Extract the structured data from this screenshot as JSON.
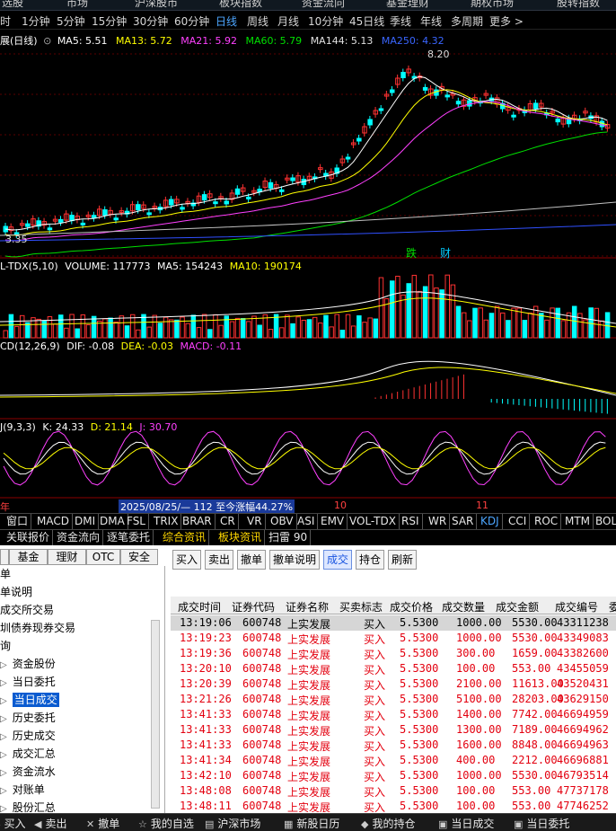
{
  "top_nav": [
    "选股",
    "市场",
    "沪深股市",
    "板块指数",
    "资金流向",
    "基金理财",
    "期权市场",
    "股转指数"
  ],
  "periods": [
    {
      "label": "时"
    },
    {
      "label": "1分钟"
    },
    {
      "label": "5分钟"
    },
    {
      "label": "15分钟"
    },
    {
      "label": "30分钟"
    },
    {
      "label": "60分钟"
    },
    {
      "label": "日线",
      "active": true
    },
    {
      "label": "周线"
    },
    {
      "label": "月线"
    },
    {
      "label": "10分钟"
    },
    {
      "label": "45日线"
    },
    {
      "label": "季线"
    },
    {
      "label": "年线"
    },
    {
      "label": "多周期"
    },
    {
      "label": "更多 >"
    }
  ],
  "kline": {
    "title": "展(日线)",
    "ma5": "MA5: 5.51",
    "ma13": "MA13: 5.72",
    "ma21": "MA21: 5.92",
    "ma60": "MA60: 5.79",
    "ma144": "MA144: 5.13",
    "ma250": "MA250: 4.32",
    "high_label": "8.20",
    "low_label": "3.35",
    "tags": [
      "跌",
      "财"
    ]
  },
  "volume": {
    "title": "L-TDX(5,10)",
    "vol": "VOLUME: 117773",
    "ma5": "MA5: 154243",
    "ma10": "MA10: 190174"
  },
  "macd": {
    "title": "CD(12,26,9)",
    "dif": "DIF: -0.08",
    "dea": "DEA: -0.03",
    "macd": "MACD: -0.11"
  },
  "kdj": {
    "title": "J(9,3,3)",
    "k": "K: 24.33",
    "d": "D: 21.14",
    "j": "J: 30.70"
  },
  "date_bar": {
    "left": "年",
    "range": "2025/08/25/— 112 至今涨幅44.27%",
    "m10": "10",
    "m11": "11"
  },
  "colors": {
    "up": "#ff3232",
    "down": "#00ffff",
    "ma5": "#ffffff",
    "ma13": "#ffff00",
    "ma21": "#ff40ff",
    "ma60": "#00e000",
    "ma144": "#c0c0c0",
    "ma250": "#3050ff",
    "table_red": "#e3000f"
  },
  "window_tabs": [
    "窗口",
    "MACD",
    "DMI",
    "DMA",
    "FSL",
    "TRIX",
    "BRAR",
    "CR",
    "VR",
    "OBV",
    "ASI",
    "EMV",
    "VOL-TDX",
    "RSI",
    "WR",
    "SAR",
    "KDJ",
    "CCI",
    "ROC",
    "MTM",
    "BOLL"
  ],
  "info_tabs": [
    "关联报价",
    "资金流向",
    "逐笔委托",
    "综合资讯",
    "板块资讯",
    "扫雷 90"
  ],
  "left_tabs": [
    "",
    "基金",
    "理财",
    "OTC",
    "安全"
  ],
  "tree": [
    {
      "label": "单"
    },
    {
      "label": "单说明"
    },
    {
      "label": "成交所交易"
    },
    {
      "label": "圳债券现券交易"
    },
    {
      "label": "询"
    },
    {
      "label": "资金股份",
      "arrow": true
    },
    {
      "label": "当日委托",
      "arrow": true
    },
    {
      "label": "当日成交",
      "arrow": true,
      "selected": true
    },
    {
      "label": "历史委托",
      "arrow": true
    },
    {
      "label": "历史成交",
      "arrow": true
    },
    {
      "label": "成交汇总",
      "arrow": true
    },
    {
      "label": "资金流水",
      "arrow": true
    },
    {
      "label": "对账单",
      "arrow": true
    },
    {
      "label": "股份汇总",
      "arrow": true
    }
  ],
  "toolbar": [
    {
      "label": "买入"
    },
    {
      "label": "卖出"
    },
    {
      "label": "撤单"
    },
    {
      "label": "撤单说明"
    },
    {
      "label": "成交",
      "active": true
    },
    {
      "label": "持仓"
    },
    {
      "label": "刷新"
    }
  ],
  "table": {
    "headers": [
      "成交时间",
      "证券代码",
      "证券名称",
      "买卖标志",
      "成交价格",
      "成交数量",
      "成交金额",
      "成交编号",
      "委"
    ],
    "rows": [
      [
        "13:19:06",
        "600748",
        "上实发展",
        "买入",
        "5.5300",
        "1000.00",
        "5530.00",
        "43311238"
      ],
      [
        "13:19:23",
        "600748",
        "上实发展",
        "买入",
        "5.5300",
        "1000.00",
        "5530.00",
        "43349083"
      ],
      [
        "13:19:36",
        "600748",
        "上实发展",
        "买入",
        "5.5300",
        "300.00",
        "1659.00",
        "43382600"
      ],
      [
        "13:20:10",
        "600748",
        "上实发展",
        "买入",
        "5.5300",
        "100.00",
        "553.00",
        "43455059"
      ],
      [
        "13:20:39",
        "600748",
        "上实发展",
        "买入",
        "5.5300",
        "2100.00",
        "11613.00",
        "43520431"
      ],
      [
        "13:21:26",
        "600748",
        "上实发展",
        "买入",
        "5.5300",
        "5100.00",
        "28203.00",
        "43629150"
      ],
      [
        "13:41:33",
        "600748",
        "上实发展",
        "买入",
        "5.5300",
        "1400.00",
        "7742.00",
        "46694959"
      ],
      [
        "13:41:33",
        "600748",
        "上实发展",
        "买入",
        "5.5300",
        "1300.00",
        "7189.00",
        "46694962"
      ],
      [
        "13:41:33",
        "600748",
        "上实发展",
        "买入",
        "5.5300",
        "1600.00",
        "8848.00",
        "46694963"
      ],
      [
        "13:41:34",
        "600748",
        "上实发展",
        "买入",
        "5.5300",
        "400.00",
        "2212.00",
        "46696881"
      ],
      [
        "13:42:10",
        "600748",
        "上实发展",
        "买入",
        "5.5300",
        "1000.00",
        "5530.00",
        "46793514"
      ],
      [
        "13:48:08",
        "600748",
        "上实发展",
        "买入",
        "5.5300",
        "100.00",
        "553.00",
        "47737178"
      ],
      [
        "13:48:11",
        "600748",
        "上实发展",
        "买入",
        "5.5300",
        "100.00",
        "553.00",
        "47746252"
      ]
    ]
  },
  "taskbar": [
    {
      "icon": "▶",
      "label": "买入"
    },
    {
      "icon": "◀",
      "label": "卖出"
    },
    {
      "icon": "✕",
      "label": "撤单"
    },
    {
      "icon": "☆",
      "label": "我的自选"
    },
    {
      "icon": "▤",
      "label": "沪深市场"
    },
    {
      "icon": "▦",
      "label": "新股日历"
    },
    {
      "icon": "◆",
      "label": "我的持仓"
    },
    {
      "icon": "▣",
      "label": "当日成交"
    },
    {
      "icon": "▣",
      "label": "当日委托"
    }
  ]
}
